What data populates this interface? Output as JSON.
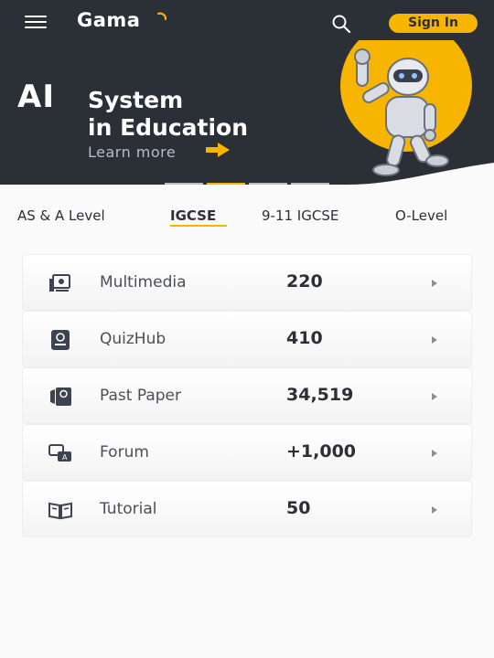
{
  "header": {
    "logo_text": "Gama",
    "sign_in_label": "Sign In",
    "menu_icon": "hamburger-menu-icon",
    "search_icon": "search-icon"
  },
  "hero": {
    "ai_text": "AI",
    "title_line1": "System",
    "title_line2": "in Education",
    "learn_more": "Learn more",
    "accent_color": "#f7b500",
    "background_color": "#2b2f36"
  },
  "tabs": [
    {
      "label": "AS & A Level",
      "active": false
    },
    {
      "label": "IGCSE",
      "active": true
    },
    {
      "label": "9-11 IGCSE",
      "active": false
    },
    {
      "label": "O-Level",
      "active": false
    }
  ],
  "items": [
    {
      "label": "Multimedia",
      "value": "220",
      "icon": "multimedia-icon"
    },
    {
      "label": "QuizHub",
      "value": "410",
      "icon": "quiz-icon"
    },
    {
      "label": "Past Paper",
      "value": "34,519",
      "icon": "past-paper-icon"
    },
    {
      "label": "Forum",
      "value": "+1,000",
      "icon": "forum-icon"
    },
    {
      "label": "Tutorial",
      "value": "50",
      "icon": "tutorial-book-icon"
    }
  ]
}
